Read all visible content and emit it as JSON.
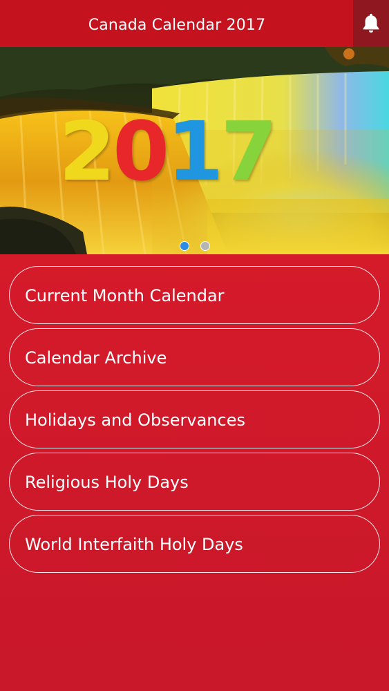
{
  "header": {
    "title": "Canada Calendar 2017",
    "notification_icon": "bell-icon"
  },
  "banner": {
    "year_digits": [
      {
        "char": "2",
        "color": "#f0d81c"
      },
      {
        "char": "0",
        "color": "#e8272b"
      },
      {
        "char": "1",
        "color": "#2196e0"
      },
      {
        "char": "7",
        "color": "#86d33b"
      }
    ],
    "slides_total": 2,
    "active_slide": 1
  },
  "menu": {
    "items": [
      {
        "label": "Current Month Calendar"
      },
      {
        "label": "Calendar Archive"
      },
      {
        "label": "Holidays and Observances"
      },
      {
        "label": "Religious Holy Days"
      },
      {
        "label": "World Interfaith Holy Days"
      }
    ]
  },
  "colors": {
    "header_bg": "#c4121f",
    "bell_button_bg": "#8e1720",
    "page_bg": "#d31a2a",
    "dot_active": "#2b8be6",
    "dot_inactive": "#b5b5b5"
  }
}
